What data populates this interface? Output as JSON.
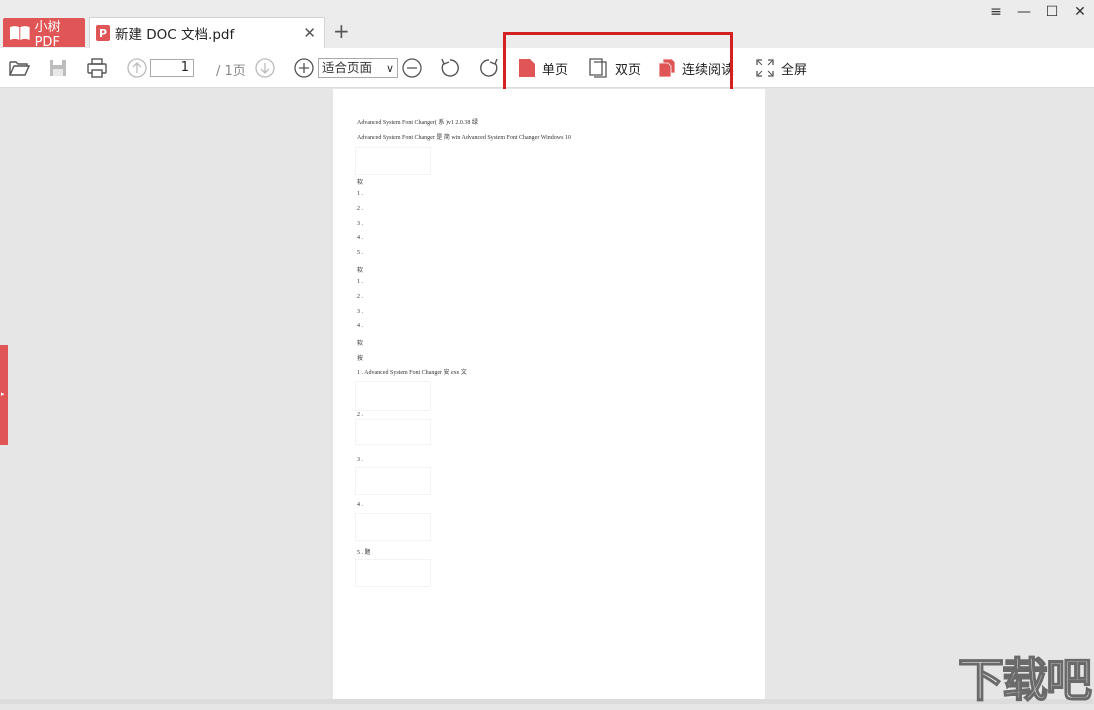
{
  "titlebar": {
    "app_tab_label": "小树PDF",
    "doc_tab_label": "新建 DOC 文档.pdf",
    "doc_badge": "P",
    "close_symbol": "✕",
    "new_tab_symbol": "+",
    "window_controls": [
      "≡",
      "—",
      "☐",
      "✕"
    ]
  },
  "toolbar": {
    "page_current": "1",
    "page_total": "/ 1页",
    "zoom_value": "适合页面",
    "view_single": "单页",
    "view_double": "双页",
    "view_continuous": "连续阅读",
    "fullscreen": "全屏"
  },
  "document": {
    "lines": [
      "Advanced System Font Changer( 系 )v1 2.0.38 绿",
      "Advanced System Font Changer 是 简 win Advanced System Font Changer Windows 10",
      "软",
      "1 .",
      "2 .",
      "3 .",
      "4 .",
      "5 .",
      "软",
      "1 .",
      "2 .",
      "3 .",
      "4 .",
      "软",
      "按",
      "1 .  Advanced System Font Changer 安 exe 文",
      "2 .",
      "3 .",
      "4 .",
      "5 . 题"
    ]
  },
  "watermark": "下载吧",
  "colors": {
    "accent": "#e05555",
    "highlight": "#d42020"
  }
}
